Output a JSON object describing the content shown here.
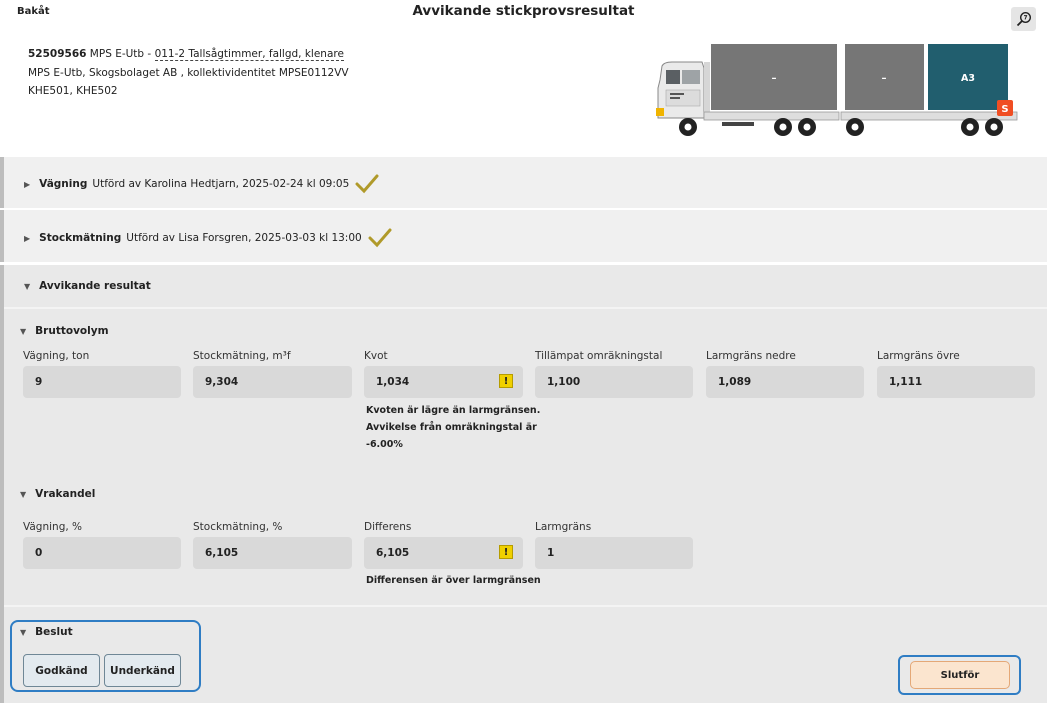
{
  "header": {
    "back_label": "Bakåt",
    "title": "Avvikande stickprovsresultat",
    "zoom_icon": "zoom-icon"
  },
  "info": {
    "id": "52509566",
    "org_prefix": "MPS E-Utb -",
    "assortment": "011-2 Tallsågtimmer, fallgd, klenare",
    "line2": "MPS E-Utb, Skogsbolaget AB , kollektividentitet MPSE0112VV",
    "line3": "KHE501, KHE502"
  },
  "truck": {
    "load1_label": "–",
    "load2_label": "–",
    "load3_label": "A3",
    "badge": "S",
    "load_color": "#767676",
    "selected_color": "#215e6e",
    "badge_color": "#f04e23"
  },
  "sections": {
    "weighing": {
      "title": "Vägning",
      "detail": "Utförd av Karolina Hedtjarn, 2025-02-24 kl 09:05"
    },
    "stock": {
      "title": "Stockmätning",
      "detail": "Utförd av Lisa Forsgren, 2025-03-03 kl 13:00"
    },
    "result": {
      "title": "Avvikande resultat"
    }
  },
  "gross": {
    "title": "Bruttovolym",
    "fields": [
      {
        "label": "Vägning, ton",
        "value": "9"
      },
      {
        "label": "Stockmätning, m³f",
        "value": "9,304"
      },
      {
        "label": "Kvot",
        "value": "1,034"
      },
      {
        "label": "Tillämpat omräkningstal",
        "value": "1,100"
      },
      {
        "label": "Larmgräns nedre",
        "value": "1,089"
      },
      {
        "label": "Larmgräns övre",
        "value": "1,111"
      }
    ],
    "warning_icon": "!",
    "message_line1": "Kvoten är lägre än larmgränsen.",
    "message_line2": "Avvikelse från omräkningstal är",
    "message_line3": "-6.00%"
  },
  "waste": {
    "title": "Vrakandel",
    "fields": [
      {
        "label": "Vägning, %",
        "value": "0"
      },
      {
        "label": "Stockmätning, %",
        "value": "6,105"
      },
      {
        "label": "Differens",
        "value": "6,105"
      },
      {
        "label": "Larmgräns",
        "value": "1"
      }
    ],
    "warning_icon": "!",
    "message": "Differensen är över larmgränsen"
  },
  "decision": {
    "title": "Beslut",
    "approve_label": "Godkänd",
    "reject_label": "Underkänd",
    "finish_label": "Slutför"
  },
  "colors": {
    "highlight_border": "#2f7dc4",
    "check": "#b09a2a",
    "warning": "#f0d000",
    "finish_bg": "#fbe5cf"
  }
}
